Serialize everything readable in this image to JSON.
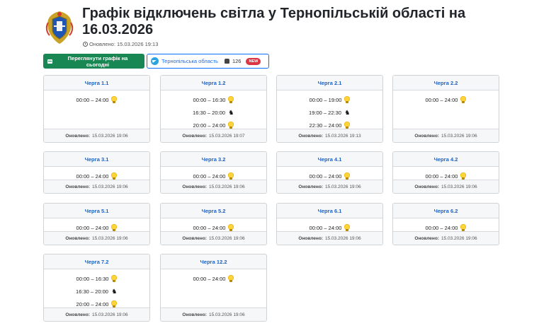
{
  "header": {
    "title": "Графік відключень світла у Тернопільській області на 16.03.2026",
    "updated": "Оновлено: 15.03.2026 19:13"
  },
  "toolbar": {
    "today_label": "Переглянути графік на сьогодні",
    "telegram_label": "Тернопільська область",
    "telegram_count": "126",
    "new_badge": "NEW"
  },
  "footer_label": "Оновлено:",
  "queues": [
    {
      "name": "Черга 1.1",
      "slots": [
        {
          "time": "00:00 – 24:00",
          "state": "on"
        }
      ],
      "updated": "15.03.2026 19:06"
    },
    {
      "name": "Черга 1.2",
      "slots": [
        {
          "time": "00:00 – 16:30",
          "state": "on"
        },
        {
          "time": "16:30 – 20:00",
          "state": "off"
        },
        {
          "time": "20:00 – 24:00",
          "state": "on"
        }
      ],
      "updated": "15.03.2026 19:07"
    },
    {
      "name": "Черга 2.1",
      "slots": [
        {
          "time": "00:00 – 19:00",
          "state": "on"
        },
        {
          "time": "19:00 – 22:30",
          "state": "off"
        },
        {
          "time": "22:30 – 24:00",
          "state": "on"
        }
      ],
      "updated": "15.03.2026 19:13"
    },
    {
      "name": "Черга 2.2",
      "slots": [
        {
          "time": "00:00 – 24:00",
          "state": "on"
        }
      ],
      "updated": "15.03.2026 19:06"
    },
    {
      "name": "Черга 3.1",
      "slots": [
        {
          "time": "00:00 – 24:00",
          "state": "on"
        }
      ],
      "updated": "15.03.2026 19:06"
    },
    {
      "name": "Черга 3.2",
      "slots": [
        {
          "time": "00:00 – 24:00",
          "state": "on"
        }
      ],
      "updated": "15.03.2026 19:06"
    },
    {
      "name": "Черга 4.1",
      "slots": [
        {
          "time": "00:00 – 24:00",
          "state": "on"
        }
      ],
      "updated": "15.03.2026 19:06"
    },
    {
      "name": "Черга 4.2",
      "slots": [
        {
          "time": "00:00 – 24:00",
          "state": "on"
        }
      ],
      "updated": "15.03.2026 19:06"
    },
    {
      "name": "Черга 5.1",
      "slots": [
        {
          "time": "00:00 – 24:00",
          "state": "on"
        }
      ],
      "updated": "15.03.2026 19:06"
    },
    {
      "name": "Черга 5.2",
      "slots": [
        {
          "time": "00:00 – 24:00",
          "state": "on"
        }
      ],
      "updated": "15.03.2026 19:06"
    },
    {
      "name": "Черга 6.1",
      "slots": [
        {
          "time": "00:00 – 24:00",
          "state": "on"
        }
      ],
      "updated": "15.03.2026 19:06"
    },
    {
      "name": "Черга 6.2",
      "slots": [
        {
          "time": "00:00 – 24:00",
          "state": "on"
        }
      ],
      "updated": "15.03.2026 19:06"
    },
    {
      "name": "Черга 7.2",
      "slots": [
        {
          "time": "00:00 – 16:30",
          "state": "on"
        },
        {
          "time": "16:30 – 20:00",
          "state": "off"
        },
        {
          "time": "20:00 – 24:00",
          "state": "on"
        }
      ],
      "updated": "15.03.2026 19:06"
    },
    {
      "name": "Черга 12.2",
      "slots": [
        {
          "time": "00:00 – 24:00",
          "state": "on"
        }
      ],
      "updated": "15.03.2026 19:06"
    }
  ]
}
